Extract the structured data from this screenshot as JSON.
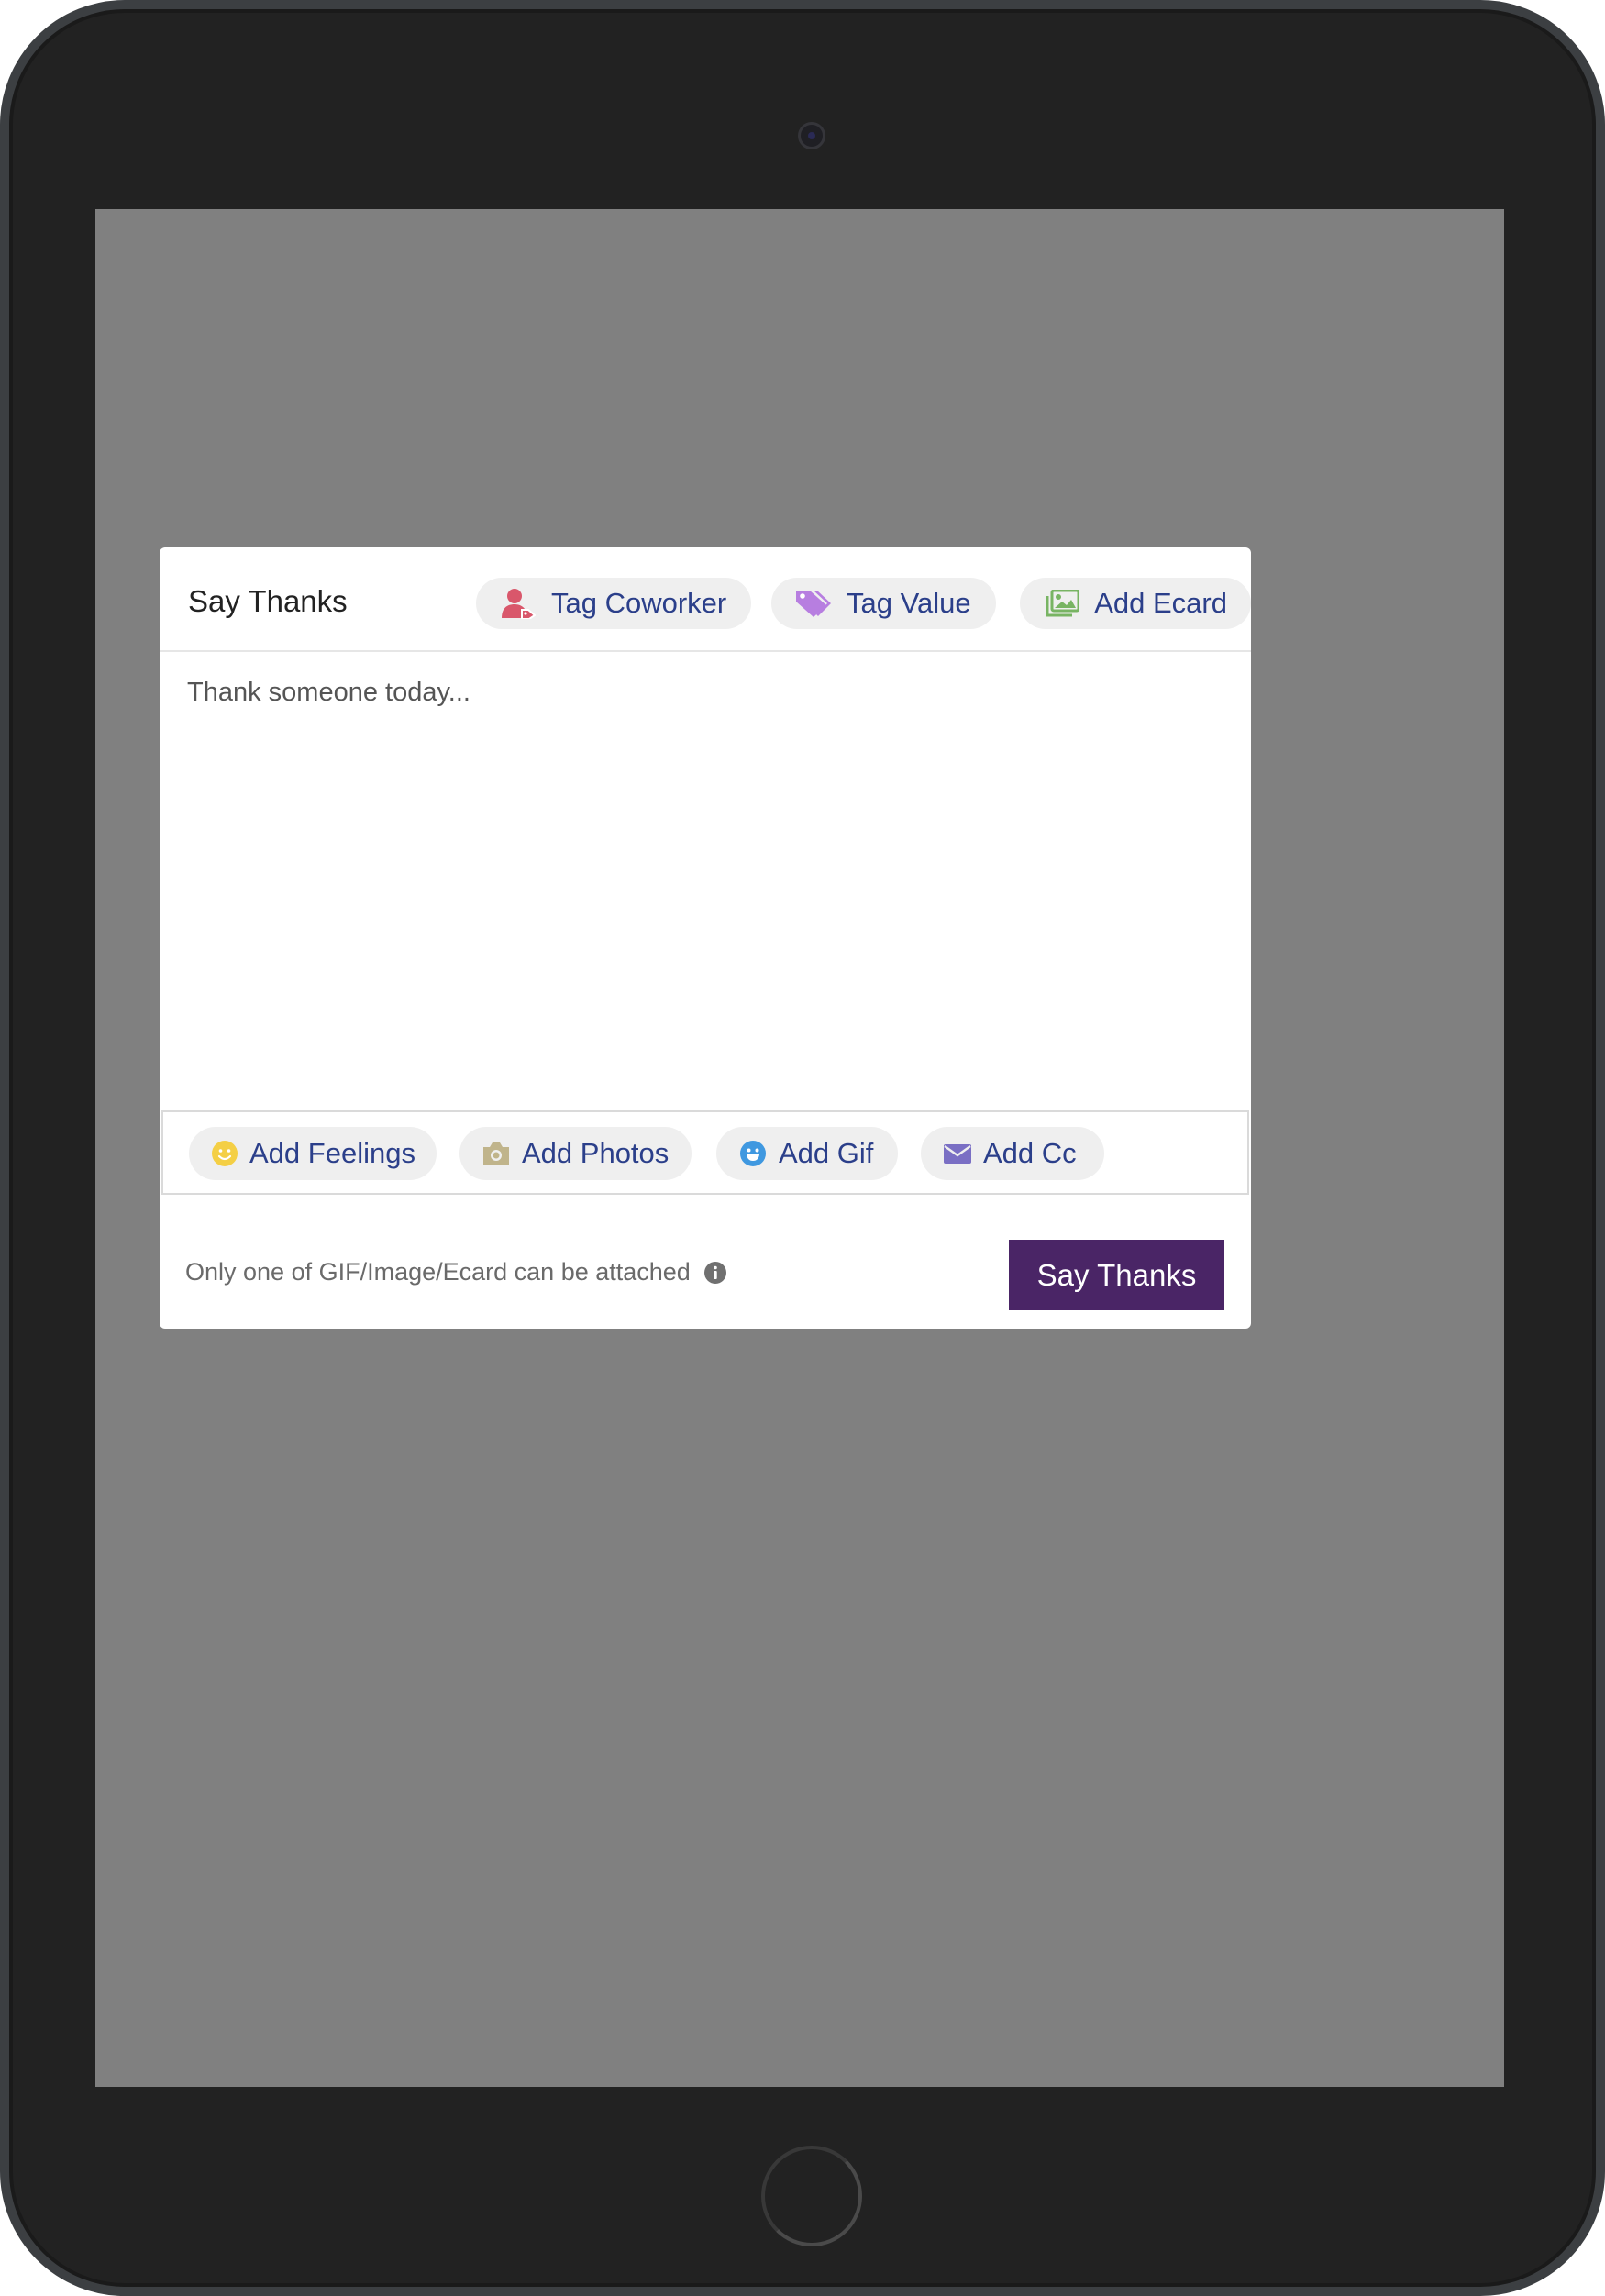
{
  "modal": {
    "title": "Say Thanks",
    "header_actions": [
      {
        "label": "Tag Coworker",
        "icon": "user-tag-icon",
        "icon_color": "#d9576b"
      },
      {
        "label": "Tag Value",
        "icon": "tag-icon",
        "icon_color": "#b77ee0"
      },
      {
        "label": "Add Ecard",
        "icon": "images-icon",
        "icon_color": "#78b463"
      }
    ],
    "close_icon": "close-icon",
    "message": {
      "placeholder": "Thank someone today...",
      "value": ""
    },
    "tools": [
      {
        "label": "Add Feelings",
        "icon": "smile-icon",
        "icon_color": "#f4cf45"
      },
      {
        "label": "Add Photos",
        "icon": "camera-icon",
        "icon_color": "#c0b48b"
      },
      {
        "label": "Add Gif",
        "icon": "gif-smile-icon",
        "icon_color": "#3f98e0"
      },
      {
        "label": "Add Cc",
        "icon": "envelope-icon",
        "icon_color": "#7a6fc4"
      }
    ],
    "footer_note": "Only one of GIF/Image/Ecard can be attached",
    "info_icon": "info-icon",
    "submit_label": "Say Thanks"
  },
  "colors": {
    "accent": "#4a2566",
    "link_text": "#2b3f8a",
    "overlay": "#808080",
    "device_frame": "#222222"
  }
}
